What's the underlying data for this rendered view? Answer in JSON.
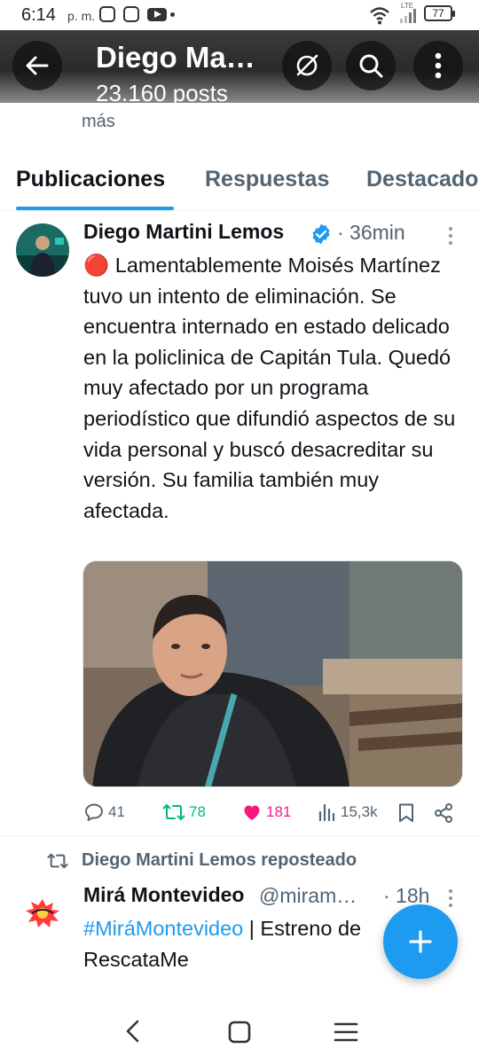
{
  "status_bar": {
    "time": "6:14",
    "ampm": "p. m.",
    "network": "LTE",
    "battery": "77"
  },
  "header": {
    "title": "Diego Ma…",
    "subtitle": "23.160 posts"
  },
  "previous_line": "más",
  "tabs": [
    {
      "label": "Publicaciones",
      "active": true
    },
    {
      "label": "Respuestas",
      "active": false
    },
    {
      "label": "Destacado",
      "active": false
    }
  ],
  "tweet": {
    "author": "Diego Martini Lemos",
    "verified": true,
    "time": "· 36min",
    "text": "🔴 Lamentablemente Moisés Martínez tuvo un intento de eliminación. Se encuentra internado en estado delicado en la policlinica de Capitán Tula. Quedó muy afectado por un programa periodístico que difundió aspectos de su vida personal y buscó desacreditar su versión. Su familia también muy afectada.",
    "actions": {
      "replies": "41",
      "reposts": "78",
      "likes": "181",
      "views": "15,3k"
    },
    "liked": true
  },
  "retweet": {
    "reposted_by": "Diego Martini Lemos reposteado",
    "author": "Mirá Montevideo",
    "handle": "@miram…",
    "time": "· 18h",
    "hashtag": "#MiráMontevideo",
    "text": " | Estreno de",
    "text_line2": "RescataMe"
  },
  "colors": {
    "accent": "#1d9bf0",
    "like": "#f91880",
    "repost": "#00ba7c",
    "secondary_text": "#536471"
  }
}
